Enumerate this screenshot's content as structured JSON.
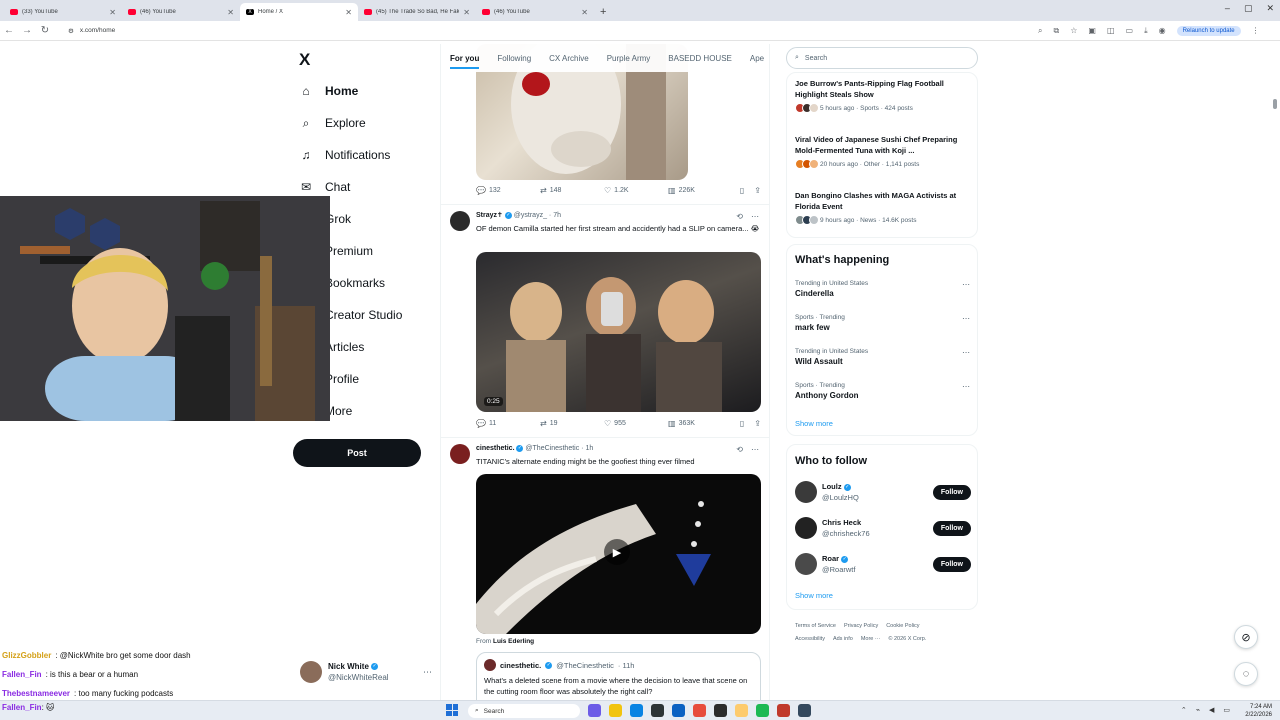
{
  "browser": {
    "tabs": [
      {
        "title": "(33) YouTube",
        "icon": "youtube-icon",
        "active": false
      },
      {
        "title": "(46) YouTube",
        "icon": "youtube-icon",
        "active": false
      },
      {
        "title": "Home / X",
        "icon": "x-icon",
        "active": true
      },
      {
        "title": "(45) The Trade So Bad, He Fake...",
        "icon": "youtube-icon",
        "active": false
      },
      {
        "title": "(46) YouTube",
        "icon": "youtube-icon",
        "active": false
      }
    ],
    "url": "x.com/home",
    "relaunch_label": "Relaunch to update"
  },
  "nav": {
    "logo": "X",
    "items": [
      {
        "label": "Home",
        "icon": "home-icon",
        "glyph": "⌂"
      },
      {
        "label": "Explore",
        "icon": "search-icon",
        "glyph": "⌕"
      },
      {
        "label": "Notifications",
        "icon": "bell-icon",
        "glyph": "🔔"
      },
      {
        "label": "Chat",
        "icon": "mail-icon",
        "glyph": "✉"
      },
      {
        "label": "Grok",
        "icon": "grok-icon",
        "glyph": "◪"
      },
      {
        "label": "Premium",
        "icon": "premium-icon",
        "glyph": "✕"
      },
      {
        "label": "Bookmarks",
        "icon": "bookmark-icon",
        "glyph": "🔖"
      },
      {
        "label": "Creator Studio",
        "icon": "creator-icon",
        "glyph": "▣"
      },
      {
        "label": "Articles",
        "icon": "articles-icon",
        "glyph": "▤"
      },
      {
        "label": "Profile",
        "icon": "profile-icon",
        "glyph": "👤"
      },
      {
        "label": "More",
        "icon": "more-icon",
        "glyph": "⋯"
      }
    ],
    "post_label": "Post",
    "account": {
      "name": "Nick White",
      "handle": "@NickWhiteReal"
    }
  },
  "feed": {
    "tabs": [
      "For you",
      "Following",
      "CX Archive",
      "Purple Army",
      "BASEDD HOUSE",
      "Ape"
    ],
    "first_actions": {
      "replies": "132",
      "reposts": "148",
      "likes": "1.2K",
      "views": "226K"
    },
    "tweets": [
      {
        "name": "Strayz✝",
        "handle": "@ystrayz_",
        "time": "· 7h",
        "text": "OF demon Camilla started her first stream and accidently had a SLIP on camera... 😭",
        "duration": "0:25",
        "replies": "11",
        "reposts": "19",
        "likes": "955",
        "views": "363K"
      },
      {
        "name": "cinesthetic.",
        "handle": "@TheCinesthetic",
        "time": "· 1h",
        "text": "TITANIC's alternate ending might be the goofiest thing ever filmed",
        "from_label": "From",
        "from_name": "Luis Ederling",
        "quote": {
          "name": "cinesthetic.",
          "handle": "@TheCinesthetic",
          "time": "· 11h",
          "text": "What's a deleted scene from a movie where the decision to leave that scene on the cutting room floor was absolutely the right call?"
        }
      }
    ]
  },
  "sidebar": {
    "search_placeholder": "Search",
    "news": [
      {
        "title": "Joe Burrow's Pants-Ripping Flag Football Highlight Steals Show",
        "meta": "5 hours ago · Sports · 424 posts"
      },
      {
        "title": "Viral Video of Japanese Sushi Chef Preparing Mold-Fermented Tuna with Koji ...",
        "meta": "20 hours ago · Other · 1,141 posts"
      },
      {
        "title": "Dan Bongino Clashes with MAGA Activists at Florida Event",
        "meta": "9 hours ago · News · 14.6K posts"
      }
    ],
    "happening_title": "What's happening",
    "trends": [
      {
        "context": "Trending in United States",
        "name": "Cinderella"
      },
      {
        "context": "Sports · Trending",
        "name": "mark few"
      },
      {
        "context": "Trending in United States",
        "name": "Wild Assault"
      },
      {
        "context": "Sports · Trending",
        "name": "Anthony Gordon"
      }
    ],
    "show_more": "Show more",
    "who_title": "Who to follow",
    "who": [
      {
        "name": "Loulz",
        "handle": "@LoulzHQ",
        "button": "Follow"
      },
      {
        "name": "Chris Heck",
        "handle": "@chrisheck76",
        "button": "Follow"
      },
      {
        "name": "Roar",
        "handle": "@Roarwtf",
        "button": "Follow"
      }
    ],
    "footer": [
      "Terms of Service",
      "Privacy Policy",
      "Cookie Policy",
      "Accessibility",
      "Ads info",
      "More ···",
      "© 2026 X Corp."
    ]
  },
  "chat": [
    {
      "user": "GlizzGobbler",
      "msg": ": @NickWhite bro get some door dash",
      "color": "#d4a017"
    },
    {
      "user": "Fallen_Fin",
      "msg": ": is this a bear or a human",
      "color": "#8a2be2"
    },
    {
      "user": "Thebestnameever",
      "msg": ": too many fucking podcasts",
      "color": "#8a2be2"
    },
    {
      "user": "Fallen_Fin",
      "msg": ": 🐱",
      "color": "#8a2be2"
    }
  ],
  "taskbar": {
    "search_label": "Search",
    "time": "7:24 AM",
    "date": "2/22/2026"
  }
}
